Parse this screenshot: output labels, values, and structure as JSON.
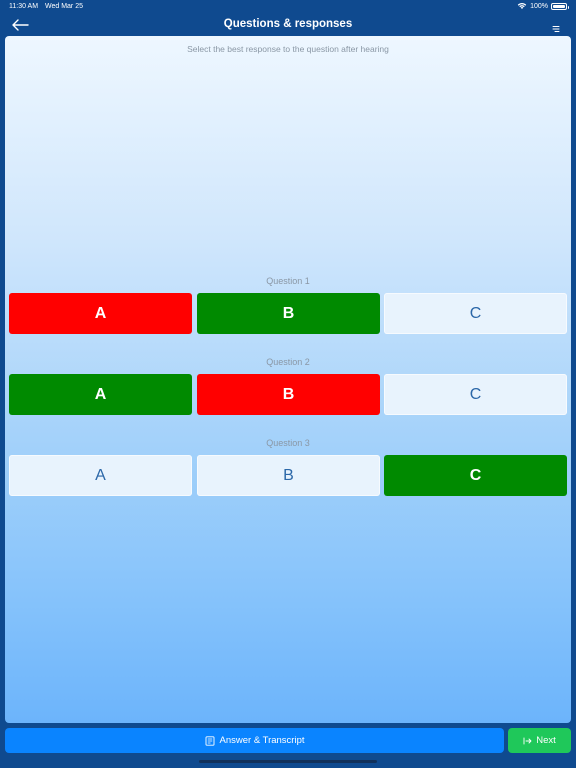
{
  "status_bar": {
    "time": "11:30 AM",
    "date": "Wed Mar 25",
    "battery": "100%"
  },
  "nav": {
    "title": "Questions & responses",
    "back_icon": "arrow-left-icon",
    "menu_icon": "menu-icon"
  },
  "instruction": "Select the best response to the question after hearing",
  "questions": [
    {
      "label": "Question 1",
      "options": [
        {
          "label": "A",
          "state": "wrong"
        },
        {
          "label": "B",
          "state": "correct"
        },
        {
          "label": "C",
          "state": "neutral"
        }
      ]
    },
    {
      "label": "Question 2",
      "options": [
        {
          "label": "A",
          "state": "correct"
        },
        {
          "label": "B",
          "state": "wrong"
        },
        {
          "label": "C",
          "state": "neutral"
        }
      ]
    },
    {
      "label": "Question 3",
      "options": [
        {
          "label": "A",
          "state": "neutral"
        },
        {
          "label": "B",
          "state": "neutral"
        },
        {
          "label": "C",
          "state": "correct"
        }
      ]
    }
  ],
  "toolbar": {
    "answer_transcript_label": "Answer & Transcript",
    "next_label": "Next"
  },
  "colors": {
    "wrong": "#ff0000",
    "correct": "#008a00",
    "neutral": "#e8f3fd",
    "accent": "#0a84ff",
    "next": "#1fc85a"
  }
}
